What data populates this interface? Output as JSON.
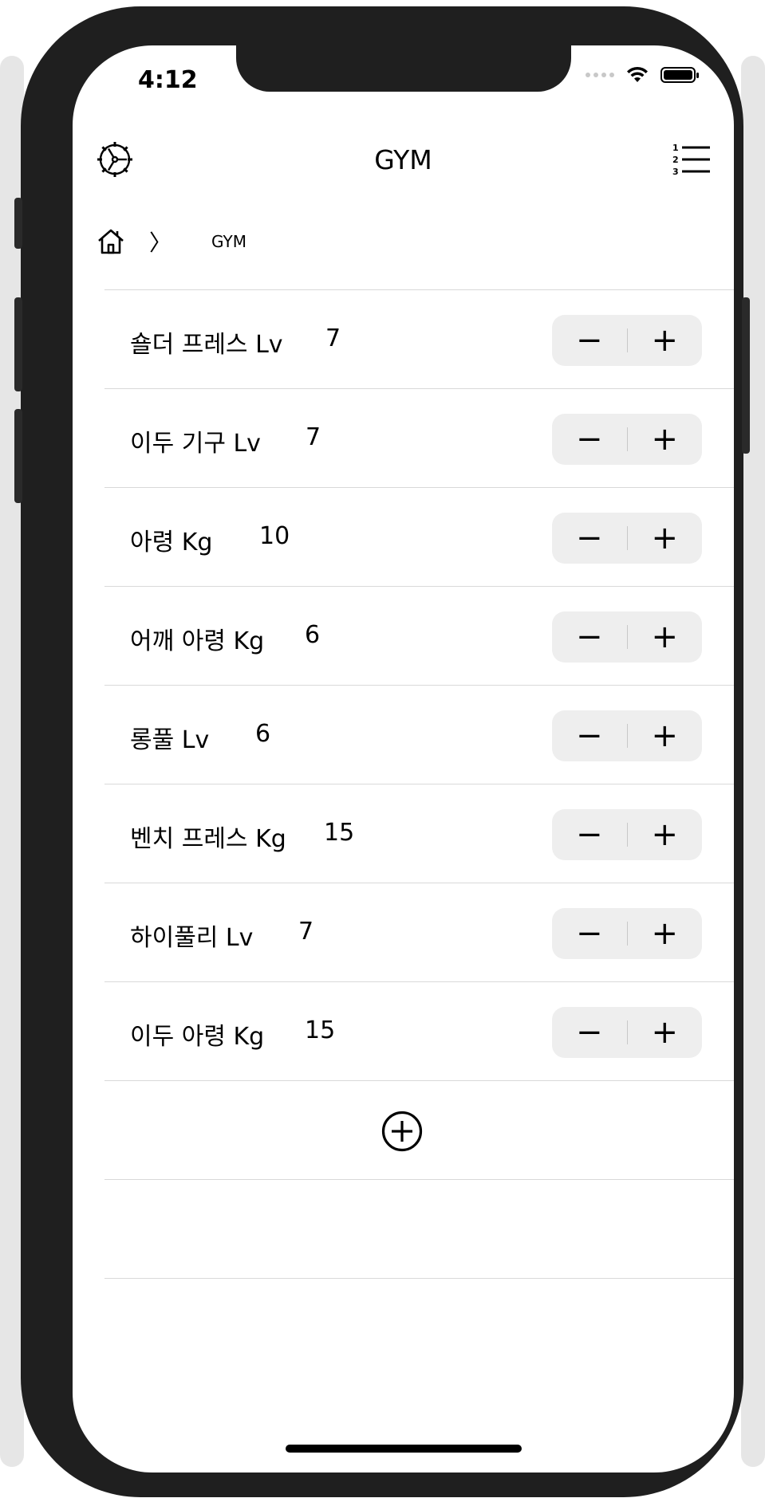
{
  "status_bar": {
    "time": "4:12"
  },
  "nav": {
    "title": "GYM",
    "left_icon": "gear-icon",
    "right_icon": "numbered-list-icon"
  },
  "breadcrumb": {
    "home_icon": "home-icon",
    "separator": "〉",
    "current": "GYM"
  },
  "exercises": [
    {
      "label": "숄더 프레스 Lv",
      "value": "7",
      "decrement": "−",
      "increment": "+"
    },
    {
      "label": "이두 기구 Lv",
      "value": "7",
      "decrement": "−",
      "increment": "+"
    },
    {
      "label": "아령 Kg",
      "value": "10",
      "decrement": "−",
      "increment": "+"
    },
    {
      "label": "어깨 아령 Kg",
      "value": "6",
      "decrement": "−",
      "increment": "+"
    },
    {
      "label": "롱풀 Lv",
      "value": "6",
      "decrement": "−",
      "increment": "+"
    },
    {
      "label": "벤치 프레스 Kg",
      "value": "15",
      "decrement": "−",
      "increment": "+"
    },
    {
      "label": "하이풀리 Lv",
      "value": "7",
      "decrement": "−",
      "increment": "+"
    },
    {
      "label": "이두 아령 Kg",
      "value": "15",
      "decrement": "−",
      "increment": "+"
    }
  ],
  "add_button_icon": "add-circle-icon",
  "colors": {
    "stepper_bg": "#eeeeee",
    "separator": "#d9d9d9",
    "phone_frame": "#1f1f1f"
  }
}
